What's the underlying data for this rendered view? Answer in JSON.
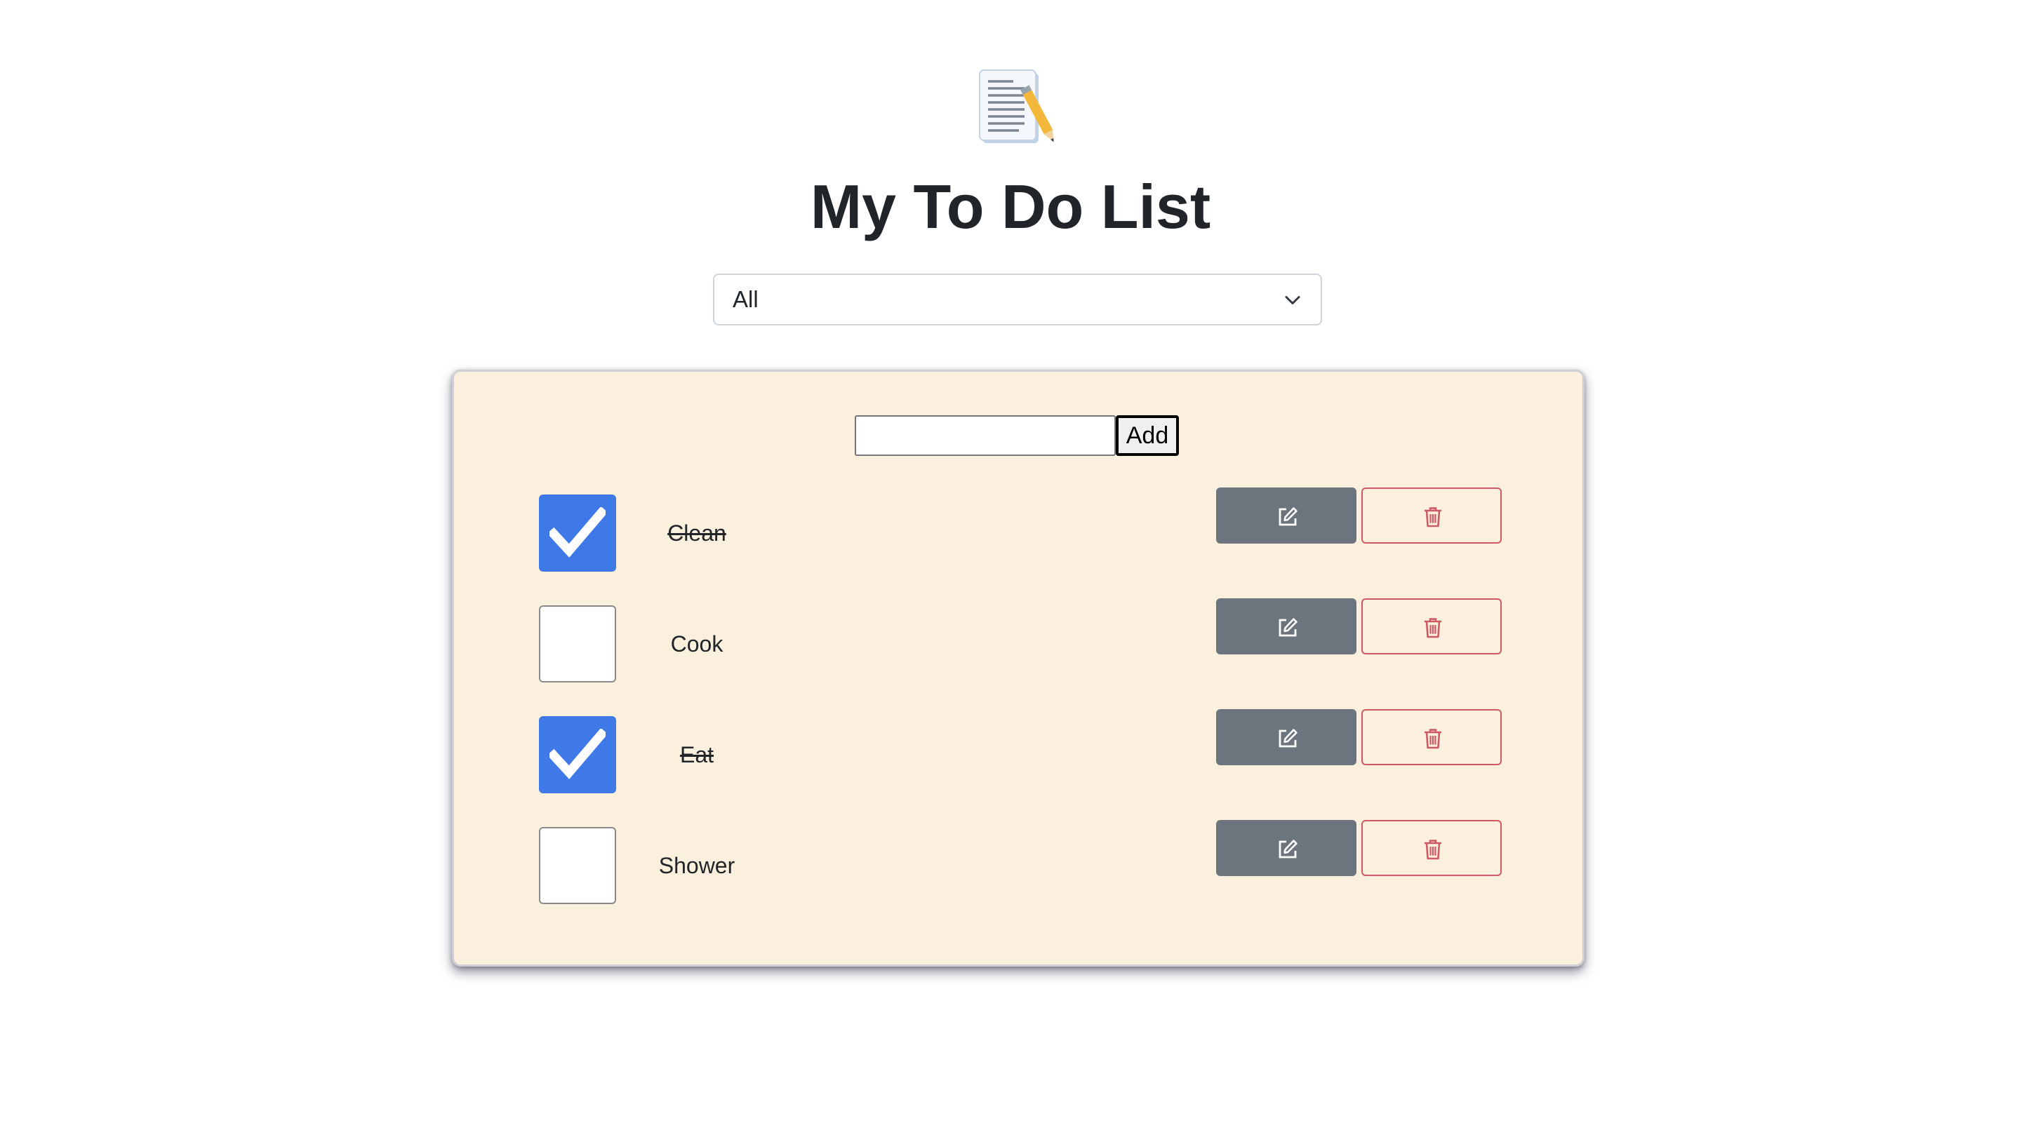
{
  "header": {
    "logo_icon": "memo-icon",
    "title": "My To Do List"
  },
  "filter": {
    "selected": "All"
  },
  "new_task": {
    "value": "",
    "add_label": "Add"
  },
  "tasks": [
    {
      "label": "Clean",
      "completed": true
    },
    {
      "label": "Cook",
      "completed": false
    },
    {
      "label": "Eat",
      "completed": true
    },
    {
      "label": "Shower",
      "completed": false
    }
  ],
  "colors": {
    "card_background": "#fbefdd",
    "checkbox_checked": "#3f78e7",
    "edit_button": "#6c757d",
    "delete_button_border": "#d05a63"
  },
  "icons": {
    "edit": "pencil-square-icon",
    "delete": "trash-icon"
  }
}
